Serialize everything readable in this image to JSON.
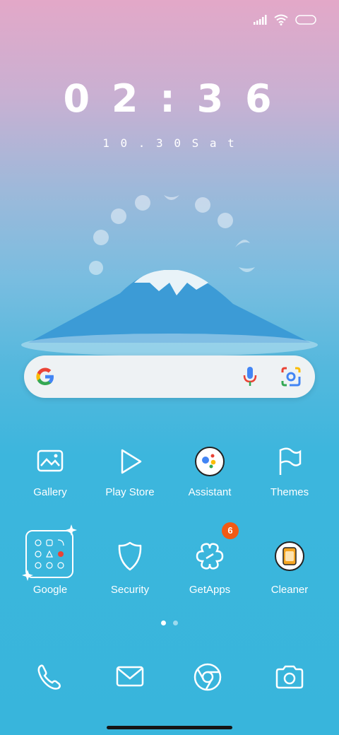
{
  "status_bar": {
    "icons": [
      "signal-icon",
      "wifi-icon",
      "battery-icon"
    ]
  },
  "lock": {
    "time": "0 2 : 3 6",
    "date": "1 0 . 3 0   S a t"
  },
  "search": {
    "icons": [
      "google-logo-icon",
      "microphone-icon",
      "google-lens-icon"
    ]
  },
  "apps_row1": [
    {
      "label": "Gallery",
      "icon": "gallery-icon"
    },
    {
      "label": "Play Store",
      "icon": "play-store-icon"
    },
    {
      "label": "Assistant",
      "icon": "assistant-icon"
    },
    {
      "label": "Themes",
      "icon": "themes-flag-icon"
    }
  ],
  "apps_row2": [
    {
      "label": "Google",
      "icon": "google-folder-icon"
    },
    {
      "label": "Security",
      "icon": "security-shield-icon"
    },
    {
      "label": "GetApps",
      "icon": "getapps-icon",
      "badge": "6"
    },
    {
      "label": "Cleaner",
      "icon": "cleaner-icon"
    }
  ],
  "dock": [
    {
      "icon": "phone-icon"
    },
    {
      "icon": "messages-icon"
    },
    {
      "icon": "chrome-browser-icon"
    },
    {
      "icon": "camera-icon"
    }
  ],
  "pager": {
    "current": 1,
    "total": 2
  },
  "colors": {
    "accent_badge": "#f25a14",
    "sky_top": "#e3a8c8",
    "sky_bottom": "#38b5dc"
  }
}
